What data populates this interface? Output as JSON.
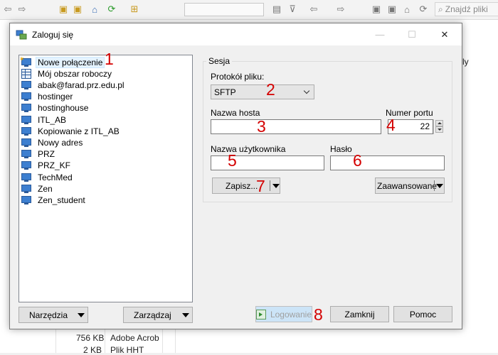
{
  "background": {
    "search_label": "Znajdź pliki",
    "right_panel_text": "ly",
    "file_rows": [
      {
        "size": "756 KB",
        "type": "Adobe Acrob"
      },
      {
        "size": "2 KB",
        "type": "Plik HHT"
      }
    ]
  },
  "dialog": {
    "title": "Zaloguj się",
    "controls": {
      "minimize": "—",
      "maximize": "☐",
      "close": "✕"
    },
    "sites": [
      {
        "label": "Nowe połączenie",
        "icon": "new-site-icon",
        "selected": true
      },
      {
        "label": "Mój obszar roboczy",
        "icon": "workspace-icon",
        "selected": false
      },
      {
        "label": "abak@farad.prz.edu.pl",
        "icon": "computer-icon",
        "selected": false
      },
      {
        "label": "hostinger",
        "icon": "computer-icon",
        "selected": false
      },
      {
        "label": "hostinghouse",
        "icon": "computer-icon",
        "selected": false
      },
      {
        "label": "ITL_AB",
        "icon": "computer-icon",
        "selected": false
      },
      {
        "label": "Kopiowanie z ITL_AB",
        "icon": "computer-icon",
        "selected": false
      },
      {
        "label": "Nowy adres",
        "icon": "computer-icon",
        "selected": false
      },
      {
        "label": "PRZ",
        "icon": "computer-icon",
        "selected": false
      },
      {
        "label": "PRZ_KF",
        "icon": "computer-icon",
        "selected": false
      },
      {
        "label": "TechMed",
        "icon": "computer-icon",
        "selected": false
      },
      {
        "label": "Zen",
        "icon": "computer-icon",
        "selected": false
      },
      {
        "label": "Zen_student",
        "icon": "computer-icon",
        "selected": false
      }
    ],
    "tools_button": "Narzędzia",
    "manage_button": "Zarządzaj",
    "session": {
      "group_title": "Sesja",
      "protocol_label": "Protokół pliku:",
      "protocol_value": "SFTP",
      "host_label": "Nazwa hosta",
      "host_value": "",
      "port_label": "Numer portu",
      "port_value": "22",
      "user_label": "Nazwa użytkownika",
      "user_value": "",
      "password_label": "Hasło",
      "password_value": "",
      "save_button": "Zapisz...",
      "advanced_button": "Zaawansowane"
    },
    "footer": {
      "login_button": "Logowanie",
      "close_button": "Zamknij",
      "help_button": "Pomoc"
    },
    "annotations": [
      "1",
      "2",
      "3",
      "4",
      "5",
      "6",
      "7",
      "8"
    ]
  },
  "colors": {
    "annotation": "#d40000",
    "selection": "#e5f3ff",
    "login_button_bg": "#cce4f7"
  }
}
